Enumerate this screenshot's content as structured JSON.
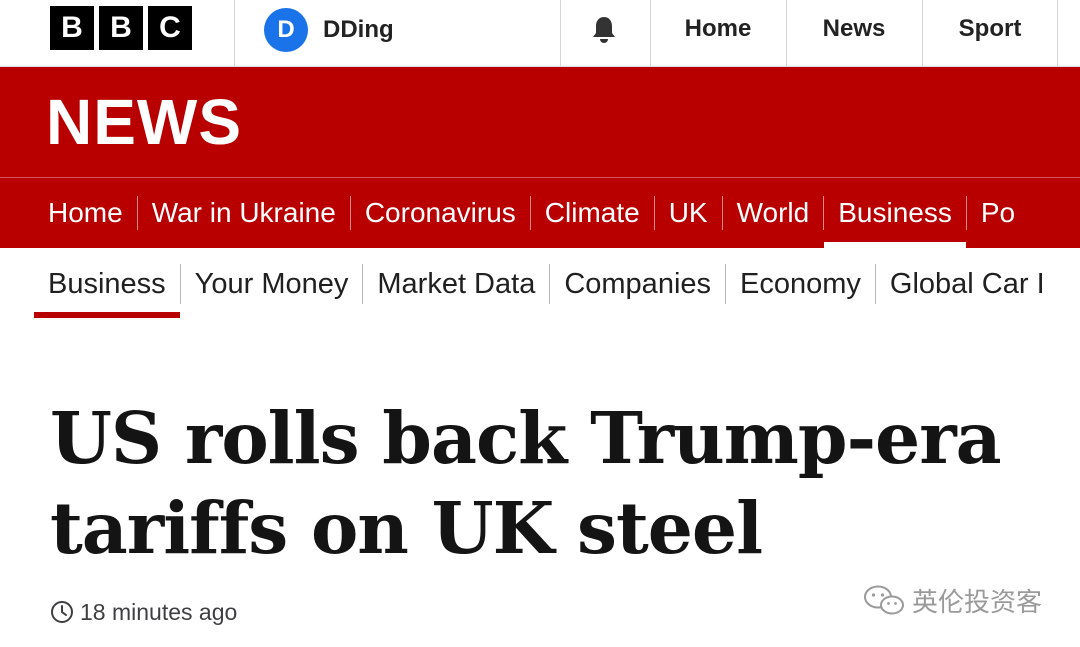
{
  "topbar": {
    "logo_letters": [
      "B",
      "B",
      "C"
    ],
    "account": {
      "initial": "D",
      "name": "DDing"
    },
    "nav": [
      "Home",
      "News",
      "Sport"
    ]
  },
  "banner": {
    "title": "NEWS"
  },
  "section_nav": [
    "Home",
    "War in Ukraine",
    "Coronavirus",
    "Climate",
    "UK",
    "World",
    "Business",
    "Po"
  ],
  "section_nav_active": "Business",
  "sub_nav": [
    "Business",
    "Your Money",
    "Market Data",
    "Companies",
    "Economy",
    "Global Car I"
  ],
  "sub_nav_active": "Business",
  "article": {
    "headline_line1": "US rolls back Trump-era",
    "headline_line2": "tariffs on UK steel",
    "timestamp": "18 minutes ago"
  },
  "watermark": {
    "text": "英伦投资客"
  },
  "colors": {
    "brand_red": "#b80000",
    "avatar_blue": "#1a73e8"
  },
  "icons": {
    "notifications": "bell-icon",
    "time": "clock-icon",
    "watermark": "wechat-icon"
  }
}
